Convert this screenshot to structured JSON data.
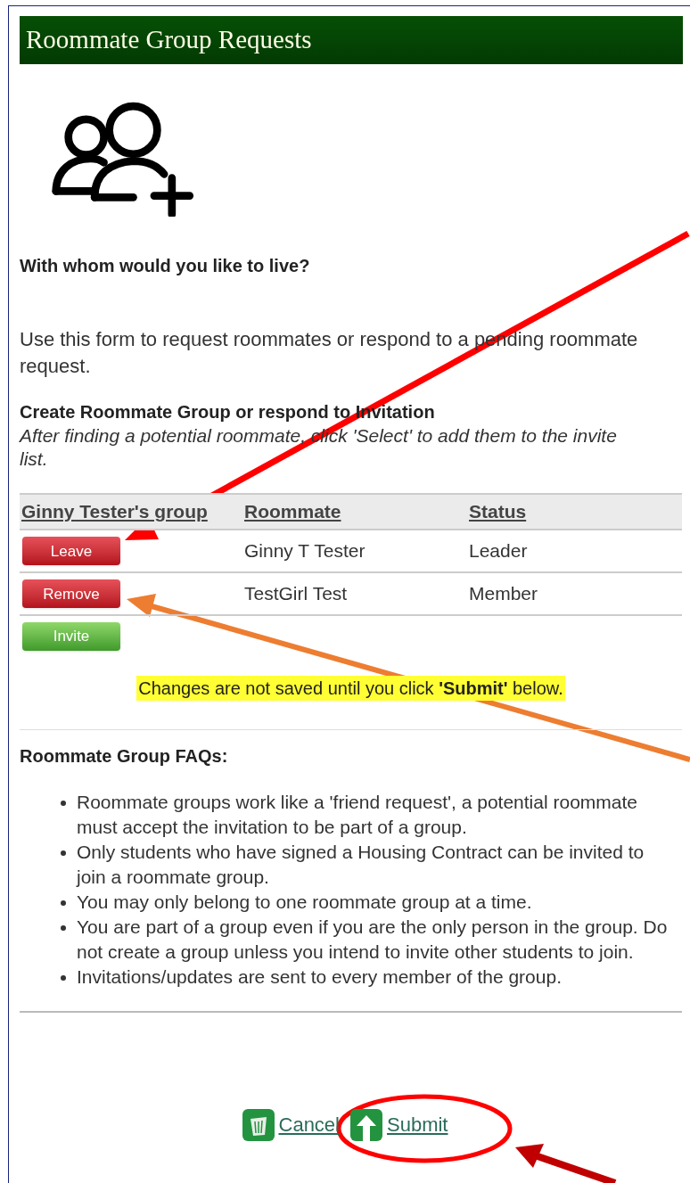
{
  "title": "Roommate Group Requests",
  "question": "With whom would you like to live?",
  "intro": "Use this form to request roommates or respond to a pending roommate request.",
  "section_heading": "Create Roommate Group or respond to Invitation",
  "instructions": "After finding a potential roommate, click 'Select' to add them to the invite list.",
  "table": {
    "columns": [
      "Ginny Tester's group",
      "Roommate",
      "Status"
    ],
    "rows": [
      {
        "action": {
          "label": "Leave",
          "kind": "danger"
        },
        "roommate": "Ginny T Tester",
        "status": "Leader"
      },
      {
        "action": {
          "label": "Remove",
          "kind": "danger"
        },
        "roommate": "TestGirl Test",
        "status": "Member"
      },
      {
        "action": {
          "label": "Invite",
          "kind": "success"
        }
      }
    ]
  },
  "notice": "Changes are not saved until you click **'Submit'** below.",
  "faq_heading": "Roommate Group FAQs:",
  "faq": [
    "Roommate groups work like a 'friend request', a potential roommate must accept the invitation to be part of a group.",
    "Only students who have signed a Housing Contract can be invited to join a roommate group.",
    "You may only belong to one roommate group at a time.",
    "You are part of a group even if you are the only person in the group. Do not create a group unless you intend to invite other students to join.",
    "Invitations/updates are sent to every member of the group."
  ],
  "links": [
    {
      "label": "Cancel",
      "kind": "cancel"
    },
    {
      "label": "Submit",
      "kind": "submit"
    }
  ]
}
